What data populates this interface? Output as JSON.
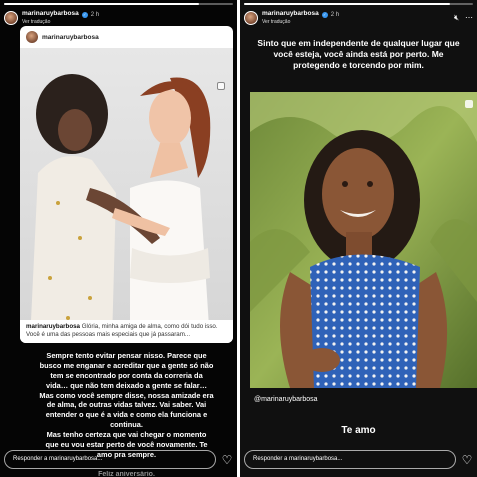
{
  "left_story": {
    "progress": 0.85,
    "username": "marinaruybarbosa",
    "time": "2 h",
    "translate": "Ver tradução",
    "post": {
      "username": "marinaruybarbosa",
      "caption_user": "marinaruybarbosa",
      "caption_text": "Glória, minha amiga de alma, como dói tudo isso. Você é uma das pessoas mais especiais que já passaram..."
    },
    "text_lines": [
      "Sempre tento evitar pensar nisso. Parece que",
      "busco me enganar e acreditar que a gente só não",
      "tem se encontrado por conta da correria da",
      "vida… que não tem deixado a gente se falar…",
      "Mas como você sempre disse, nossa amizade era",
      "de alma, de outras vidas talvez. Vai saber. Vai",
      "entender o que é a vida e como ela funciona e",
      "continua.",
      "Mas tenho certeza que vai chegar o momento",
      "que eu vou estar perto de você novamente. Te",
      "amo pra sempre."
    ],
    "cropped_line": "Feliz aniversário.",
    "reply_placeholder": "Responder a marinaruybarbosa...",
    "heart_icon": "heart-icon"
  },
  "right_story": {
    "progress": 0.9,
    "username": "marinaruybarbosa",
    "time": "2 h",
    "translate": "Ver tradução",
    "quote": "Sinto que em independente de qualquer lugar que você esteja, você ainda está por perto. Me protegendo e torcendo por mim.",
    "mention": "@marinaruybarbosa",
    "te_amo": "Te amo",
    "reply_placeholder": "Responder a marinaruybarbosa...",
    "mute_icon": "speaker-muted-icon",
    "more_icon": "more-options-icon",
    "heart_icon": "heart-icon"
  }
}
